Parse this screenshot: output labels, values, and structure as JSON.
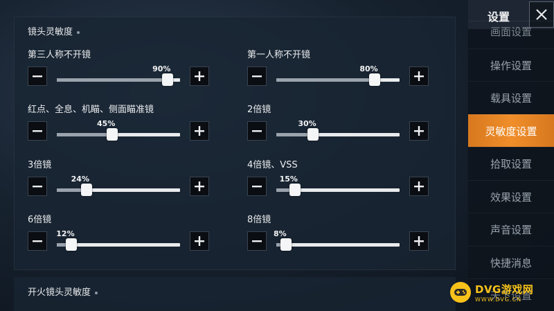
{
  "sidebar": {
    "title": "设置",
    "items": [
      {
        "label": "画面设置",
        "active": false
      },
      {
        "label": "操作设置",
        "active": false
      },
      {
        "label": "载具设置",
        "active": false
      },
      {
        "label": "灵敏度设置",
        "active": true
      },
      {
        "label": "拾取设置",
        "active": false
      },
      {
        "label": "效果设置",
        "active": false
      },
      {
        "label": "声音设置",
        "active": false
      },
      {
        "label": "快捷消息",
        "active": false
      },
      {
        "label": "天下设置",
        "active": false
      }
    ]
  },
  "section1": {
    "title": "镜头灵敏度",
    "settings": [
      {
        "label": "第三人称不开镜",
        "value": 90,
        "display": "90%"
      },
      {
        "label": "第一人称不开镜",
        "value": 80,
        "display": "80%"
      },
      {
        "label": "红点、全息、机瞄、侧面瞄准镜",
        "value": 45,
        "display": "45%"
      },
      {
        "label": "2倍镜",
        "value": 30,
        "display": "30%"
      },
      {
        "label": "3倍镜",
        "value": 24,
        "display": "24%"
      },
      {
        "label": "4倍镜、VSS",
        "value": 15,
        "display": "15%"
      },
      {
        "label": "6倍镜",
        "value": 12,
        "display": "12%"
      },
      {
        "label": "8倍镜",
        "value": 8,
        "display": "8%"
      }
    ]
  },
  "section2": {
    "title": "开火镜头灵敏度"
  },
  "watermark": {
    "main": "DVG游戏网",
    "sub": "WWW.DVG.CN"
  },
  "colors": {
    "accent": "#f08e2a",
    "watermark": "#f7c21a"
  }
}
